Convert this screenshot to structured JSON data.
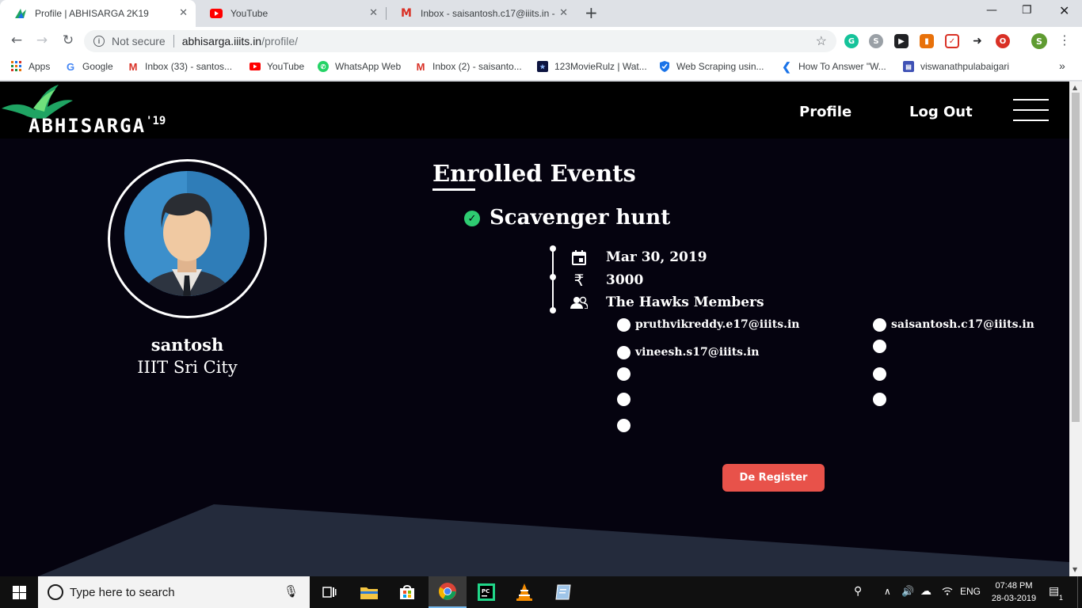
{
  "browser": {
    "tabs": [
      {
        "title": "Profile | ABHISARGA 2K19",
        "icon": "abhisarga-icon",
        "active": true
      },
      {
        "title": "YouTube",
        "icon": "youtube-icon",
        "active": false
      },
      {
        "title": "Inbox - saisantosh.c17@iiits.in - I",
        "icon": "gmail-icon",
        "active": false
      }
    ],
    "omnibox": {
      "security_label": "Not secure",
      "host": "abhisarga.iiits.in",
      "path": "/profile/"
    },
    "profile_initial": "S",
    "bookmarks": [
      {
        "label": "Apps",
        "icon": "apps-grid-icon"
      },
      {
        "label": "Google",
        "icon": "google-icon"
      },
      {
        "label": "Inbox (33) - santos...",
        "icon": "gmail-icon"
      },
      {
        "label": "YouTube",
        "icon": "youtube-icon"
      },
      {
        "label": "WhatsApp Web",
        "icon": "whatsapp-icon"
      },
      {
        "label": "Inbox (2) - saisanto...",
        "icon": "gmail-icon"
      },
      {
        "label": "123MovieRulz | Wat...",
        "icon": "movierulz-icon"
      },
      {
        "label": "Web Scraping usin...",
        "icon": "shield-icon"
      },
      {
        "label": "How To Answer \"W...",
        "icon": "how-to-icon"
      },
      {
        "label": "viswanathpulabaigari",
        "icon": "bookmark-page-icon"
      }
    ],
    "bookmarks_overflow": "»"
  },
  "site": {
    "logo_text": "ABHISARGA",
    "logo_year": "'19",
    "nav": {
      "profile": "Profile",
      "logout": "Log Out"
    },
    "user": {
      "name": "santosh",
      "college": "IIIT Sri City"
    },
    "section_title": "Enrolled Events",
    "event": {
      "name": "Scavenger hunt",
      "date": "Mar 30, 2019",
      "fee": "3000",
      "team": "The Hawks Members",
      "members_left": [
        "pruthvikreddy.e17@iiits.in",
        "vineesh.s17@iiits.in",
        "",
        "",
        ""
      ],
      "members_right": [
        "saisantosh.c17@iiits.in",
        "",
        "",
        ""
      ]
    },
    "deregister_label": "De Register",
    "colors": {
      "background": "#05030f",
      "accent": "#e8524a",
      "check": "#2ecc71"
    }
  },
  "taskbar": {
    "search_placeholder": "Type here to search",
    "language": "ENG",
    "time": "07:48 PM",
    "date": "28-03-2019",
    "notification_count": "1"
  }
}
